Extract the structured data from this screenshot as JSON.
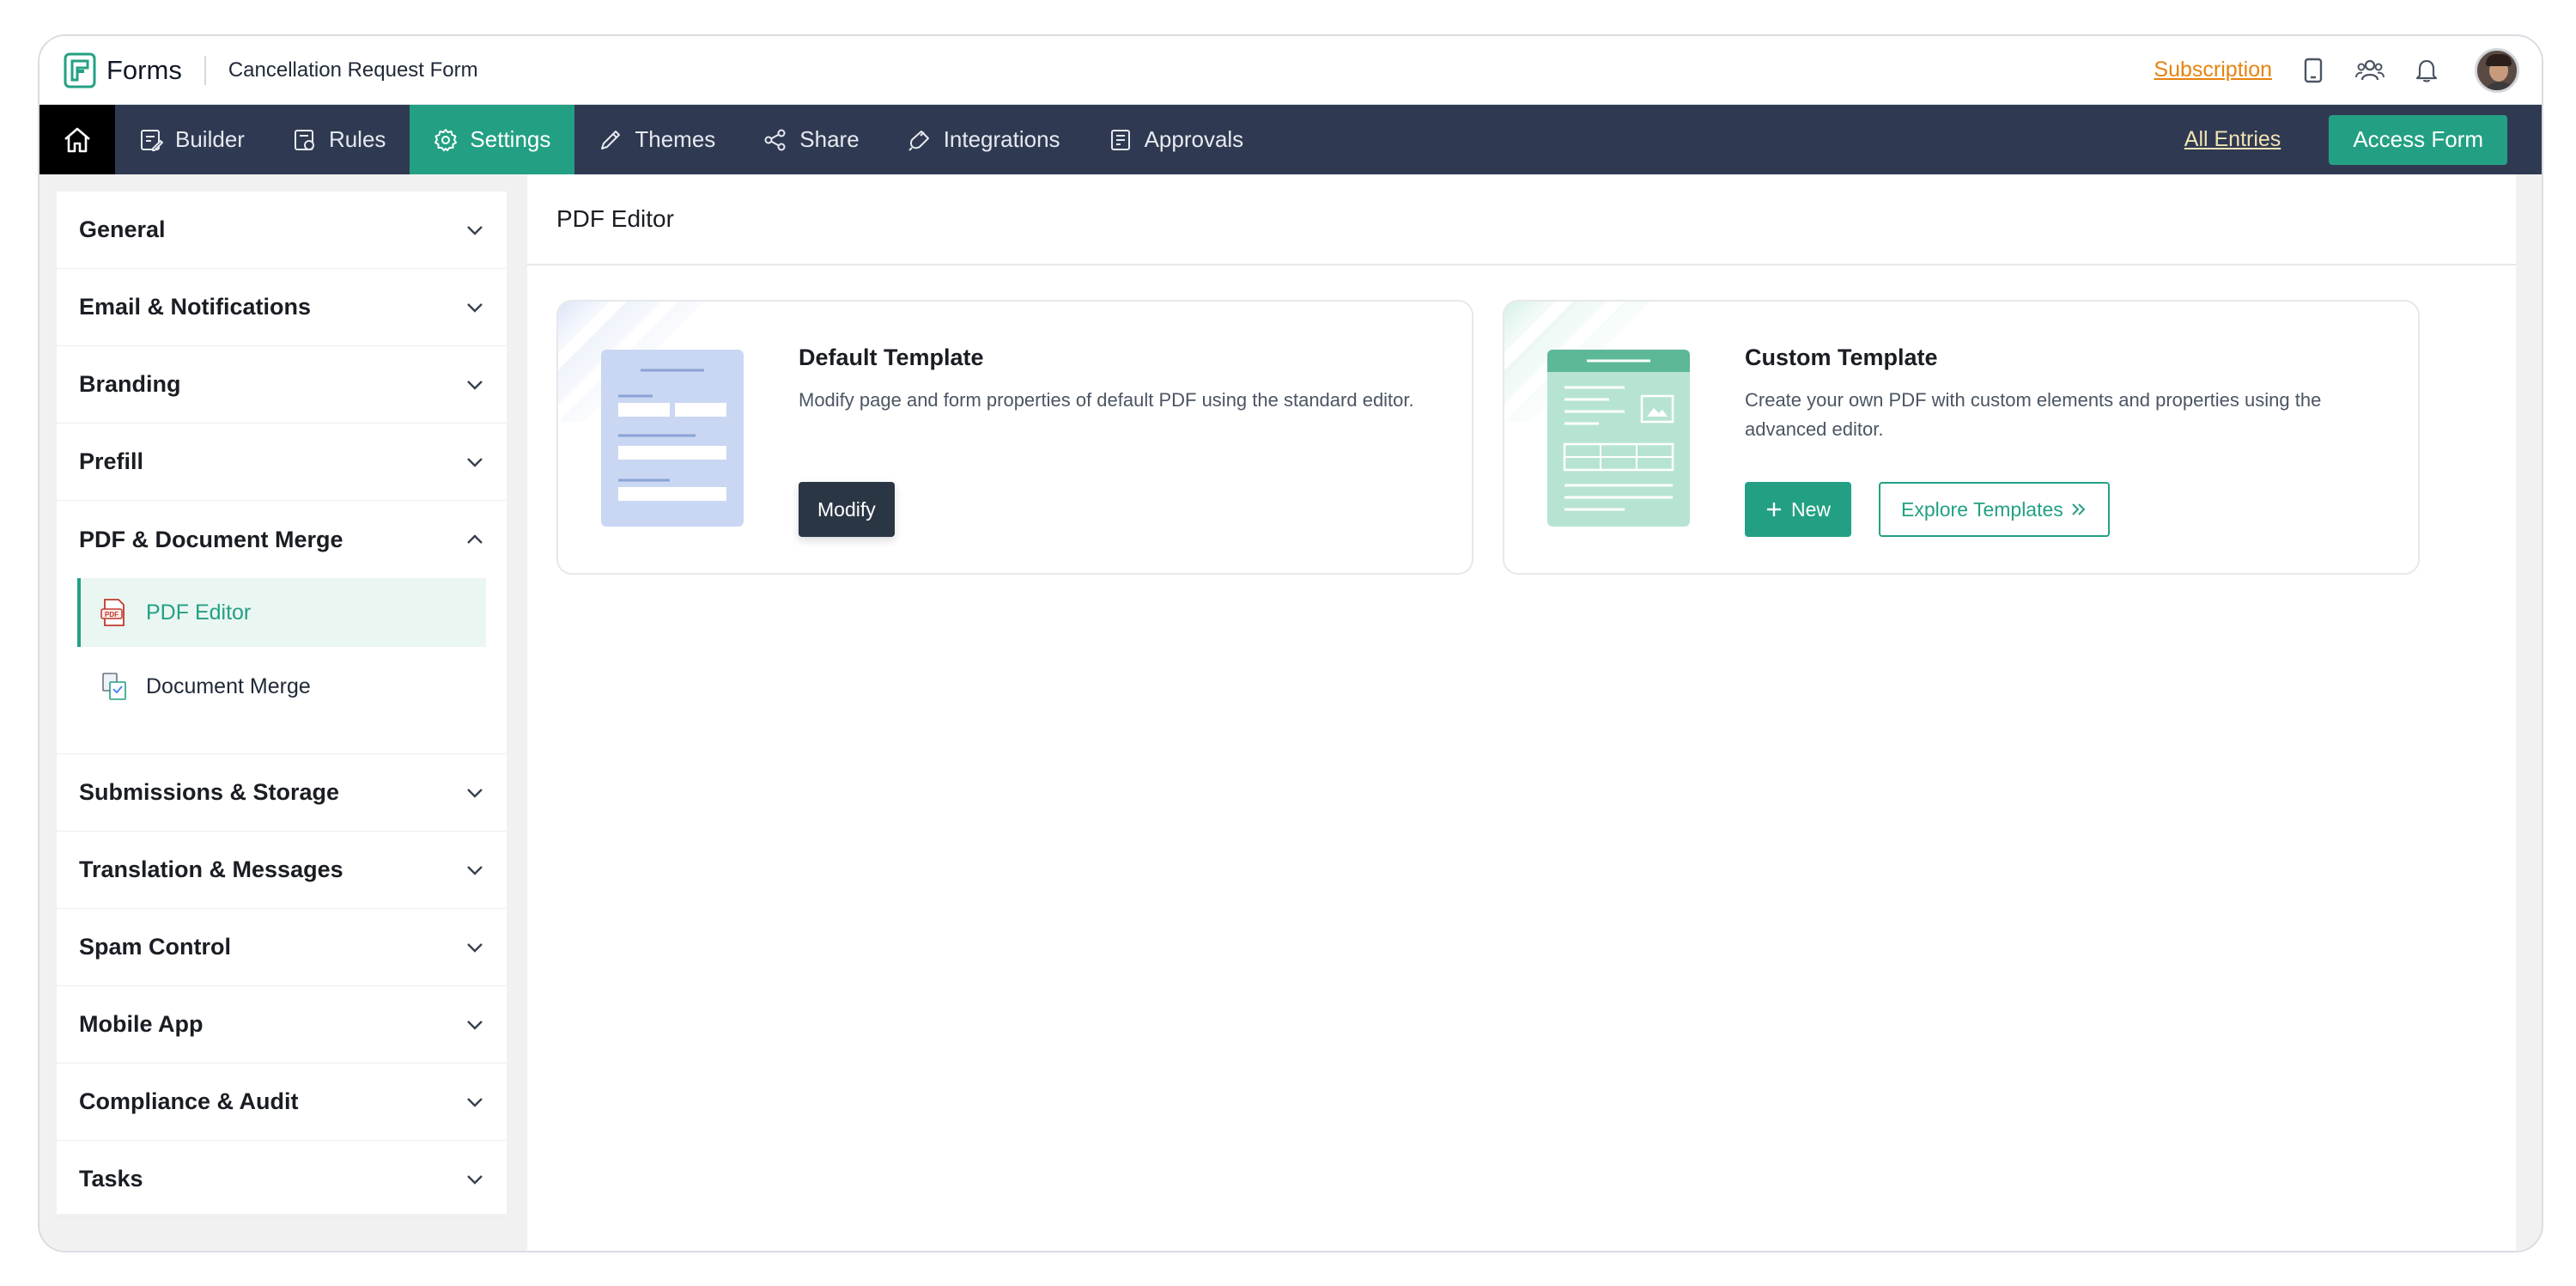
{
  "app": {
    "name": "Forms",
    "form_name": "Cancellation Request Form",
    "subscription_label": "Subscription"
  },
  "nav": {
    "items": [
      {
        "label": "Builder",
        "icon": "builder-icon"
      },
      {
        "label": "Rules",
        "icon": "rules-icon"
      },
      {
        "label": "Settings",
        "icon": "gear-icon",
        "active": true
      },
      {
        "label": "Themes",
        "icon": "brush-icon"
      },
      {
        "label": "Share",
        "icon": "share-icon"
      },
      {
        "label": "Integrations",
        "icon": "plug-icon"
      },
      {
        "label": "Approvals",
        "icon": "approvals-icon"
      }
    ],
    "all_entries": "All Entries",
    "access_form": "Access Form"
  },
  "sidebar": {
    "sections": [
      {
        "label": "General"
      },
      {
        "label": "Email & Notifications"
      },
      {
        "label": "Branding"
      },
      {
        "label": "Prefill"
      },
      {
        "label": "PDF & Document Merge",
        "open": true
      },
      {
        "label": "Submissions & Storage"
      },
      {
        "label": "Translation & Messages"
      },
      {
        "label": "Spam Control"
      },
      {
        "label": "Mobile App"
      },
      {
        "label": "Compliance & Audit"
      },
      {
        "label": "Tasks"
      }
    ],
    "sub_items": [
      {
        "label": "PDF Editor",
        "active": true,
        "icon": "pdf-icon"
      },
      {
        "label": "Document Merge",
        "icon": "document-merge-icon"
      }
    ]
  },
  "main": {
    "title": "PDF Editor",
    "cards": {
      "default": {
        "title": "Default Template",
        "description": "Modify page and form properties of default PDF using the standard editor.",
        "button": "Modify"
      },
      "custom": {
        "title": "Custom Template",
        "description": "Create your own PDF with custom elements and properties using the advanced editor.",
        "new_button": "New",
        "explore_button": "Explore Templates"
      }
    }
  },
  "colors": {
    "accent": "#23a084",
    "nav_bg": "#2f3a52",
    "subscription": "#e6830f"
  }
}
